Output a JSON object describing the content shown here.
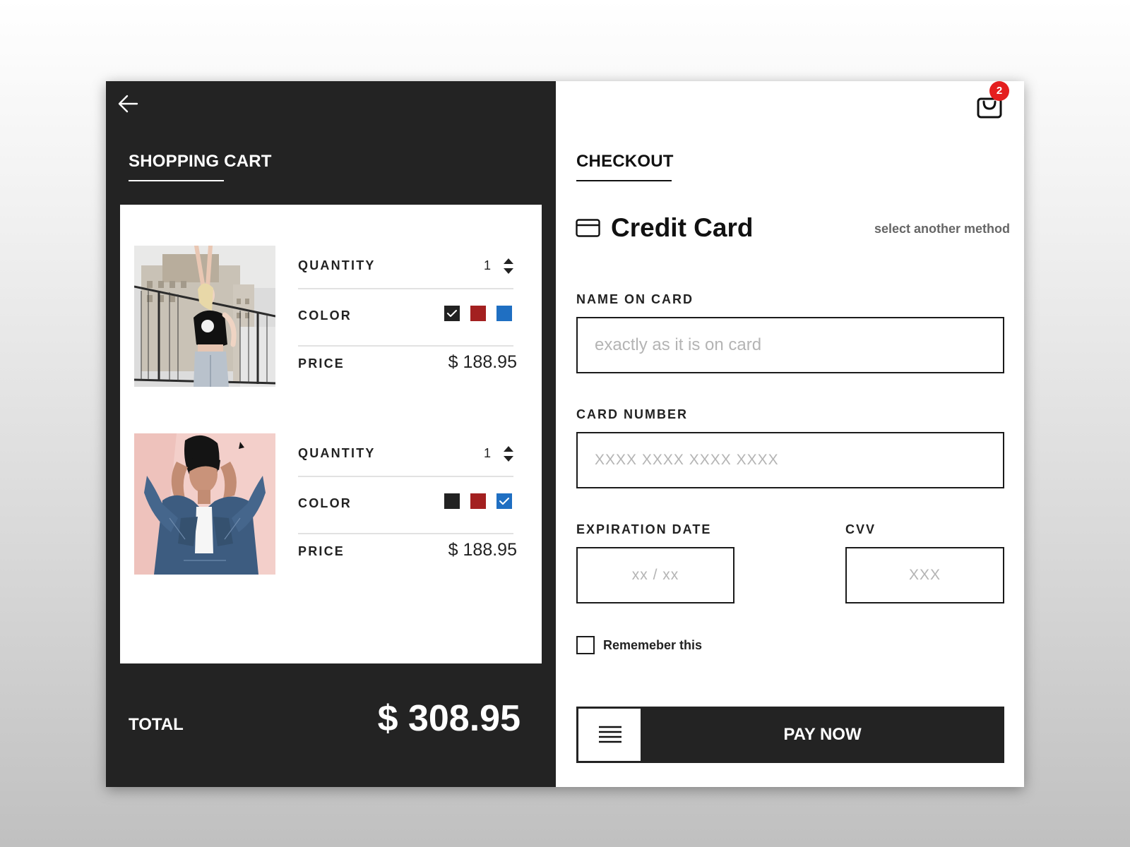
{
  "cart": {
    "title": "SHOPPING CART",
    "back_icon": "arrow-left-icon",
    "items": [
      {
        "quantity_label": "QUANTITY",
        "quantity": "1",
        "color_label": "COLOR",
        "colors": [
          "#222222",
          "#a32020",
          "#1f6fc2"
        ],
        "selected_color": 0,
        "price_label": "PRICE",
        "price": "$ 188.95"
      },
      {
        "quantity_label": "QUANTITY",
        "quantity": "1",
        "color_label": "COLOR",
        "colors": [
          "#222222",
          "#a32020",
          "#1f6fc2"
        ],
        "selected_color": 2,
        "price_label": "PRICE",
        "price": "$ 188.95"
      }
    ],
    "total_label": "TOTAL",
    "total": "$ 308.95"
  },
  "checkout": {
    "title": "CHECKOUT",
    "bag_icon": "shopping-bag-icon",
    "bag_count": "2",
    "method_icon": "credit-card-icon",
    "method_title": "Credit Card",
    "method_link": "select another method",
    "name_label": "NAME ON CARD",
    "name_placeholder": "exactly as it is on card",
    "number_label": "CARD NUMBER",
    "number_placeholder": "XXXX XXXX XXXX XXXX",
    "exp_label": "EXPIRATION DATE",
    "exp_placeholder": "xx / xx",
    "cvv_label": "CVV",
    "cvv_placeholder": "XXX",
    "remember_label": "Rememeber this",
    "remember_checked": false,
    "pay_label": "PAY NOW",
    "pay_icon": "menu-icon"
  },
  "colors": {
    "dark_panel": "#232323",
    "badge": "#e41e1e",
    "swatch_black": "#222222",
    "swatch_red": "#a32020",
    "swatch_blue": "#1f6fc2"
  }
}
